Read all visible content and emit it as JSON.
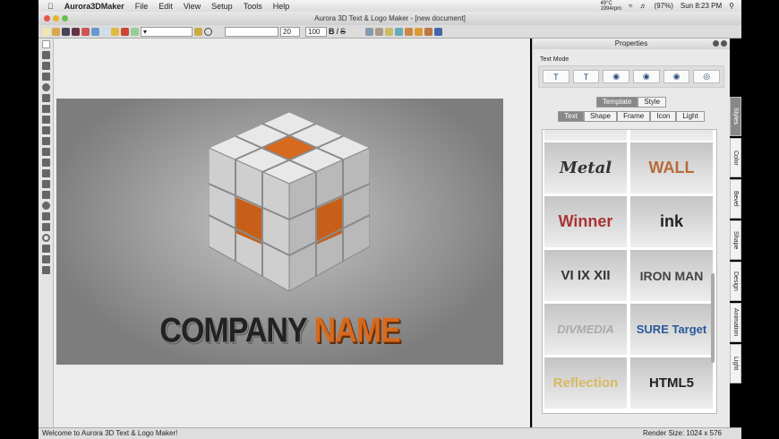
{
  "menubar": {
    "app": "Aurora3DMaker",
    "items": [
      "File",
      "Edit",
      "View",
      "Setup",
      "Tools",
      "Help"
    ],
    "temp": "49°C",
    "rpm": "1994rpm",
    "battery": "(97%)",
    "clock": "Sun 8:23 PM"
  },
  "window": {
    "title": "Aurora 3D Text & Logo Maker - [new document]"
  },
  "toolbar": {
    "font_size": "20",
    "scale": "100",
    "bold": "B",
    "italic": "I",
    "strike": "S"
  },
  "canvas": {
    "company": "COMPANY",
    "name": "NAME"
  },
  "properties": {
    "title": "Properties",
    "text_mode_label": "Text Mode",
    "tabs": [
      "Template",
      "Style"
    ],
    "subtabs": [
      "Text",
      "Shape",
      "Frame",
      "Icon",
      "Light"
    ],
    "templates": [
      "Metal",
      "WALL",
      "Winner",
      "ink",
      "VI IX XII",
      "IRON MAN",
      "DIVMEDIA",
      "SURE Target",
      "Reflection",
      "HTML5"
    ]
  },
  "side_tabs": [
    "Styles",
    "Color",
    "Bevel",
    "Shape",
    "Design",
    "Animation",
    "Light"
  ],
  "status": {
    "message": "Welcome to Aurora 3D Text & Logo Maker!",
    "render_size": "Render Size: 1024 x 576"
  }
}
